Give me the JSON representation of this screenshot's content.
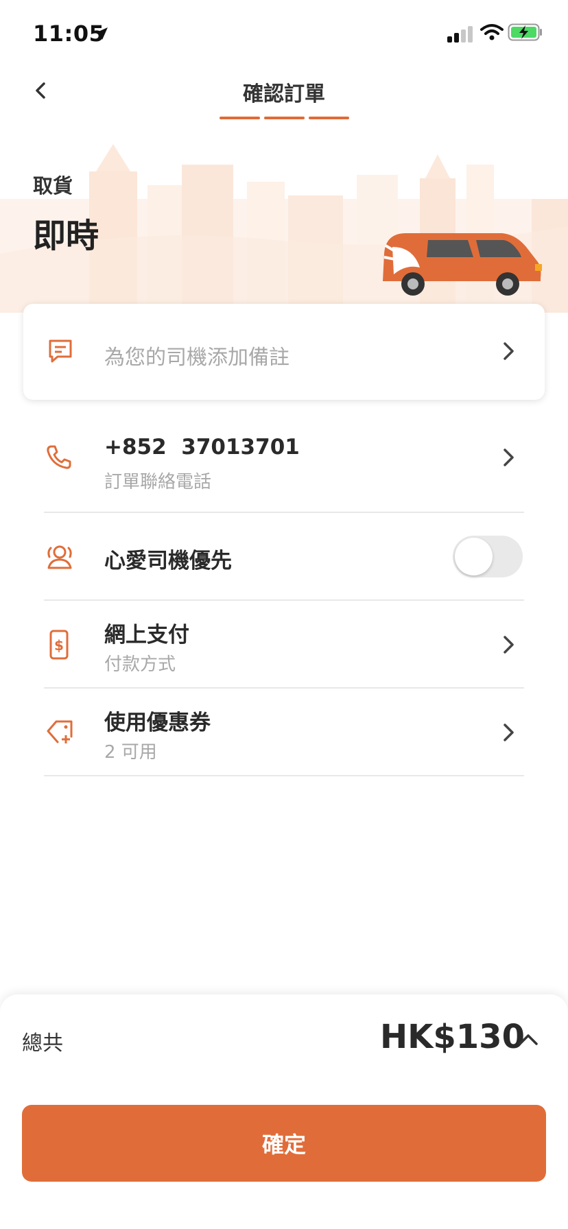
{
  "status_bar": {
    "time": "11:05"
  },
  "nav": {
    "title": "確認訂單",
    "steps": 3
  },
  "pickup": {
    "label": "取貨",
    "value": "即時"
  },
  "note": {
    "placeholder": "為您的司機添加備註"
  },
  "rows": [
    {
      "main": "+852  37013701",
      "sub": "訂單聯絡電話"
    },
    {
      "main": "心愛司機優先",
      "toggle_on": false
    },
    {
      "main": "網上支付",
      "sub": "付款方式"
    },
    {
      "main": "使用優惠券",
      "sub": "2 可用"
    }
  ],
  "footer": {
    "total_label": "總共",
    "total_value": "HK$130",
    "confirm_label": "確定"
  },
  "colors": {
    "accent": "#e06d39",
    "muted_text": "#a8a8a8",
    "divider": "#e8e8e8"
  }
}
